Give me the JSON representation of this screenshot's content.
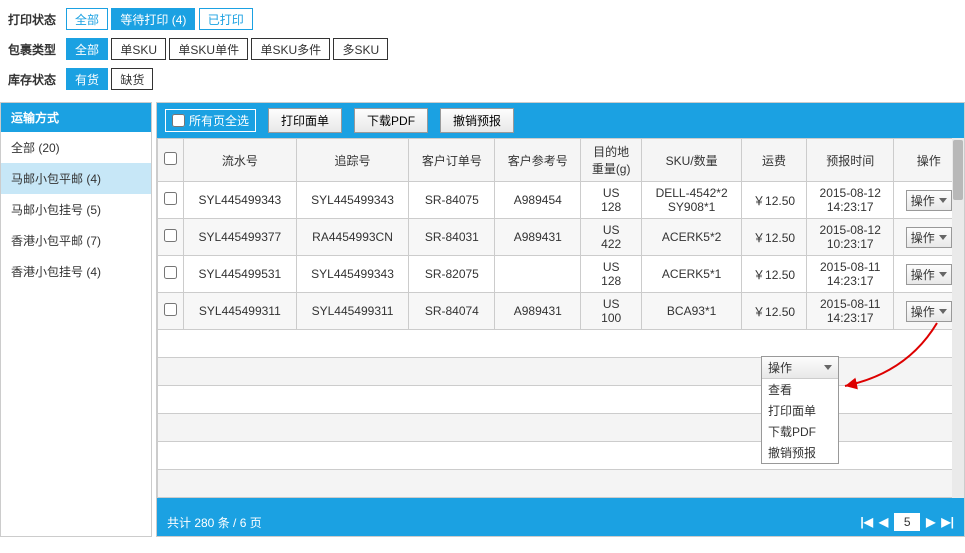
{
  "filters": {
    "print_status": {
      "label": "打印状态",
      "options": [
        "全部",
        "等待打印 (4)",
        "已打印"
      ],
      "active": 1,
      "plain": []
    },
    "package_type": {
      "label": "包裹类型",
      "options": [
        "全部",
        "单SKU",
        "单SKU单件",
        "单SKU多件",
        "多SKU"
      ],
      "active": 0,
      "plain": [
        1,
        2,
        3,
        4
      ]
    },
    "stock_status": {
      "label": "库存状态",
      "options": [
        "有货",
        "缺货"
      ],
      "active": 0,
      "plain": [
        1
      ]
    }
  },
  "sidebar": {
    "header": "运输方式",
    "items": [
      "全部 (20)",
      "马邮小包平邮 (4)",
      "马邮小包挂号 (5)",
      "香港小包平邮 (7)",
      "香港小包挂号 (4)"
    ],
    "selected": 1
  },
  "toolbar": {
    "select_all": "所有页全选",
    "btn_print": "打印面单",
    "btn_pdf": "下载PDF",
    "btn_cancel": "撤销预报"
  },
  "columns": [
    "",
    "流水号",
    "追踪号",
    "客户订单号",
    "客户参考号",
    "目的地重量(g)",
    "SKU/数量",
    "运费",
    "预报时间",
    "操作"
  ],
  "rows": [
    {
      "serial": "SYL445499343",
      "track": "SYL445499343",
      "order": "SR-84075",
      "ref": "A989454",
      "dest": "US 128",
      "sku": "DELL-4542*2 SY908*1",
      "fee": "￥12.50",
      "time": "2015-08-12 14:23:17"
    },
    {
      "serial": "SYL445499377",
      "track": "RA4454993CN",
      "order": "SR-84031",
      "ref": "A989431",
      "dest": "US 422",
      "sku": "ACERK5*2",
      "fee": "￥12.50",
      "time": "2015-08-12 10:23:17"
    },
    {
      "serial": "SYL445499531",
      "track": "SYL445499343",
      "order": "SR-82075",
      "ref": "",
      "dest": "US 128",
      "sku": "ACERK5*1",
      "fee": "￥12.50",
      "time": "2015-08-11 14:23:17"
    },
    {
      "serial": "SYL445499311",
      "track": "SYL445499311",
      "order": "SR-84074",
      "ref": "A989431",
      "dest": "US 100",
      "sku": "BCA93*1",
      "fee": "￥12.50",
      "time": "2015-08-11 14:23:17"
    }
  ],
  "op_label": "操作",
  "dropdown": {
    "header": "操作",
    "items": [
      "查看",
      "打印面单",
      "下载PDF",
      "撤销预报"
    ]
  },
  "pager": {
    "summary": "共计 280 条 / 6 页",
    "page": "5"
  }
}
